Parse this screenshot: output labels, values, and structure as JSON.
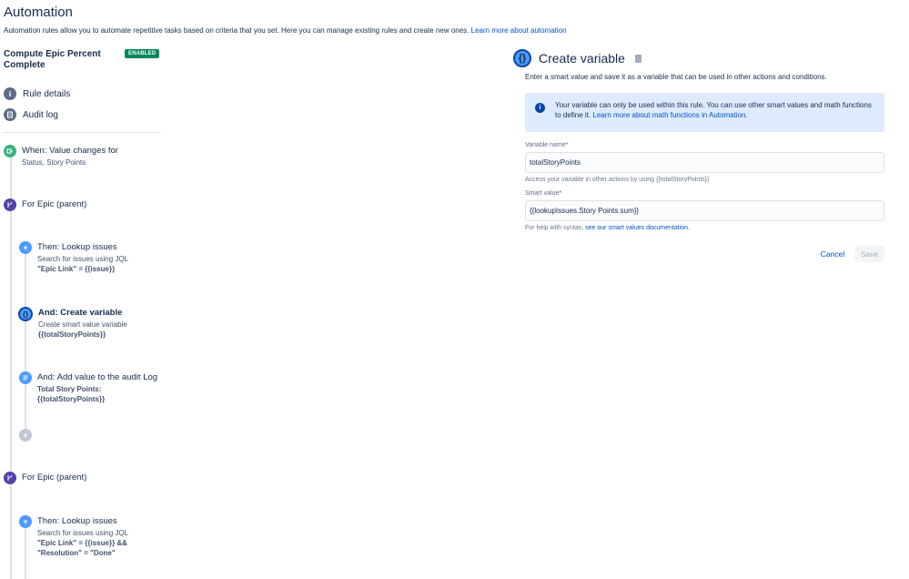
{
  "header": {
    "title": "Automation",
    "description": "Automation rules allow you to automate repetitive tasks based on criteria that you set. Here you can manage existing rules and create new ones.",
    "learn_more": "Learn more about automation"
  },
  "rule": {
    "name": "Compute Epic Percent Complete",
    "status": "ENABLED"
  },
  "nav": {
    "rule_details": "Rule details",
    "audit_log": "Audit log"
  },
  "steps": [
    {
      "title": "When: Value changes for",
      "sub1": "Status, Story Points"
    },
    {
      "title": "For Epic (parent)"
    },
    {
      "title": "Then: Lookup issues",
      "sub1": "Search for issues using JQL",
      "sub2": "\"Epic Link\" = {{issue}}"
    },
    {
      "title": "And: Create variable",
      "sub1": "Create smart value variable",
      "sub2": "{{totalStoryPoints}}"
    },
    {
      "title": "And: Add value to the audit Log",
      "sub1": "Total Story Points:",
      "sub2": "{{totalStoryPoints}}"
    },
    {
      "title": "For Epic (parent)"
    },
    {
      "title": "Then: Lookup issues",
      "sub1": "Search for issues using JQL",
      "sub2": "\"Epic Link\" = {{issue}} &&",
      "sub3": "\"Resolution\" = \"Done\""
    }
  ],
  "panel": {
    "title": "Create variable",
    "description": "Enter a smart value and save it as a variable that can be used in other actions and conditions.",
    "info_text": "Your variable can only be used within this rule. You can use other smart values and math functions to define it.",
    "info_link": "Learn more about math functions in Automation.",
    "variable_name_label": "Variable name",
    "variable_name_value": "totalStoryPoints",
    "variable_help": "Access your variable in other actions by using {{totalStoryPoints}}",
    "smart_value_label": "Smart value",
    "smart_value_value": "{{lookupIssues.Story Points.sum}}",
    "smart_help_prefix": "For help with syntax,",
    "smart_help_link": "see our smart values documentation.",
    "cancel": "Cancel",
    "save": "Save"
  },
  "colors": {
    "enabled_badge": "#00875a",
    "link": "#0052cc",
    "info_bg": "#deebff",
    "trigger": "#36b37e",
    "branch": "#5243aa",
    "action": "#4c9aff"
  }
}
